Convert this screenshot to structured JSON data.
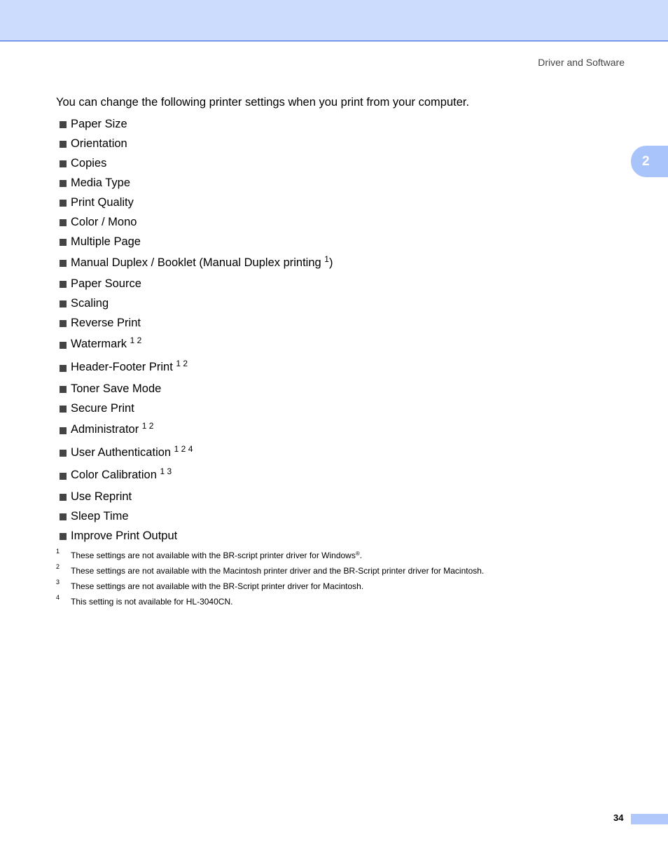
{
  "header": {
    "running_head": "Driver and Software",
    "chapter_number": "2",
    "colors": {
      "band": "#ccdcfc",
      "rule": "#1c4fd8",
      "tab": "#a9c4fb"
    }
  },
  "intro": "You can change the following printer settings when you print from your computer.",
  "settings": [
    {
      "label": "Paper Size",
      "notes": ""
    },
    {
      "label": "Orientation",
      "notes": ""
    },
    {
      "label": "Copies",
      "notes": ""
    },
    {
      "label": "Media Type",
      "notes": ""
    },
    {
      "label": "Print Quality",
      "notes": ""
    },
    {
      "label": "Color / Mono",
      "notes": ""
    },
    {
      "label": "Multiple Page",
      "notes": ""
    },
    {
      "label": "Manual Duplex / Booklet (Manual Duplex printing ",
      "notes": "1",
      "suffix": ")"
    },
    {
      "label": "Paper Source",
      "notes": ""
    },
    {
      "label": "Scaling",
      "notes": ""
    },
    {
      "label": "Reverse Print",
      "notes": ""
    },
    {
      "label": "Watermark ",
      "notes": "1 2"
    },
    {
      "label": "Header-Footer Print ",
      "notes": "1 2"
    },
    {
      "label": "Toner Save Mode",
      "notes": ""
    },
    {
      "label": "Secure Print",
      "notes": ""
    },
    {
      "label": "Administrator ",
      "notes": "1 2"
    },
    {
      "label": "User Authentication ",
      "notes": "1 2 4"
    },
    {
      "label": "Color Calibration ",
      "notes": "1 3"
    },
    {
      "label": "Use Reprint",
      "notes": ""
    },
    {
      "label": "Sleep Time",
      "notes": ""
    },
    {
      "label": "Improve Print Output",
      "notes": ""
    }
  ],
  "footnotes": [
    {
      "num": "1",
      "text": "These settings are not available with the BR-script printer driver for Windows",
      "reg": "®",
      "end": "."
    },
    {
      "num": "2",
      "text": "These settings are not available with the Macintosh printer driver and the BR-Script printer driver for Macintosh.",
      "reg": "",
      "end": ""
    },
    {
      "num": "3",
      "text": "These settings are not available with the BR-Script printer driver for Macintosh.",
      "reg": "",
      "end": ""
    },
    {
      "num": "4",
      "text": "This setting is not available for HL-3040CN.",
      "reg": "",
      "end": ""
    }
  ],
  "footer": {
    "page_number": "34"
  }
}
